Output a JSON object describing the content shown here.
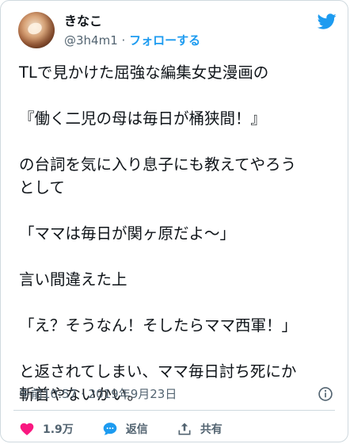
{
  "header": {
    "display_name": "きなこ",
    "handle": "@3h4m1",
    "separator": "·",
    "follow_label": "フォローする"
  },
  "tweet": {
    "lines": [
      "TLで見かけた屈強な編集女史漫画の",
      "",
      "『働く二児の母は毎日が桶狭間！』",
      "",
      "の台詞を気に入り息子にも教えてやろう",
      "として",
      "",
      "「ママは毎日が関ヶ原だよ〜」",
      "",
      "言い間違えた上",
      "",
      "「え？そうなん！そしたらママ西軍！」",
      "",
      "と返されてしまい、ママ毎日討ち死にか",
      "斬首やないかい。"
    ]
  },
  "meta": {
    "timestamp": "午前10:57 · 2019年9月23日"
  },
  "actions": {
    "like_count": "1.9万",
    "reply_label": "返信",
    "share_label": "共有"
  },
  "icons": {
    "twitter_logo": "twitter-bird-icon",
    "info": "info-icon",
    "like": "heart-icon",
    "reply": "reply-bubble-icon",
    "share": "share-upload-icon"
  },
  "colors": {
    "accent": "#1d9bf0",
    "like": "#f91880",
    "secondary_text": "#536471",
    "border": "#cfd9de"
  }
}
